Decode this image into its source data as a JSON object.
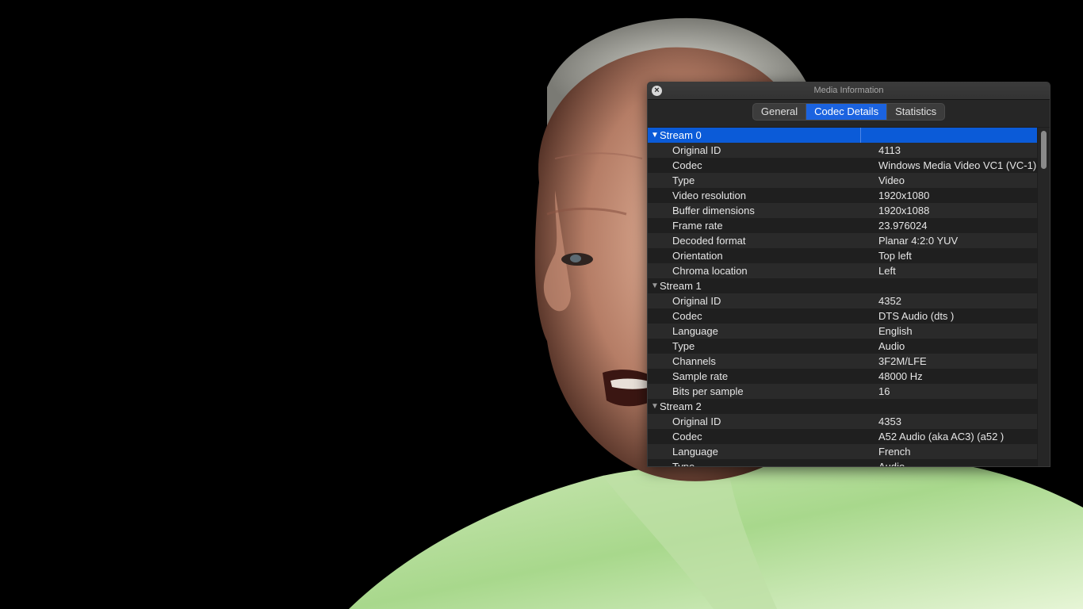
{
  "window": {
    "title": "Media Information"
  },
  "tabs": [
    {
      "label": "General",
      "active": false
    },
    {
      "label": "Codec Details",
      "active": true
    },
    {
      "label": "Statistics",
      "active": false
    }
  ],
  "streams": [
    {
      "label": "Stream 0",
      "selected": true,
      "rows": [
        {
          "key": "Original ID",
          "value": "4113"
        },
        {
          "key": "Codec",
          "value": "Windows Media Video VC1 (VC-1)"
        },
        {
          "key": "Type",
          "value": "Video"
        },
        {
          "key": "Video resolution",
          "value": "1920x1080"
        },
        {
          "key": "Buffer dimensions",
          "value": "1920x1088"
        },
        {
          "key": "Frame rate",
          "value": "23.976024"
        },
        {
          "key": "Decoded format",
          "value": "Planar 4:2:0 YUV"
        },
        {
          "key": "Orientation",
          "value": "Top left"
        },
        {
          "key": "Chroma location",
          "value": "Left"
        }
      ]
    },
    {
      "label": "Stream 1",
      "selected": false,
      "rows": [
        {
          "key": "Original ID",
          "value": "4352"
        },
        {
          "key": "Codec",
          "value": "DTS Audio (dts )"
        },
        {
          "key": "Language",
          "value": "English"
        },
        {
          "key": "Type",
          "value": "Audio"
        },
        {
          "key": "Channels",
          "value": "3F2M/LFE"
        },
        {
          "key": "Sample rate",
          "value": "48000 Hz"
        },
        {
          "key": "Bits per sample",
          "value": "16"
        }
      ]
    },
    {
      "label": "Stream 2",
      "selected": false,
      "rows": [
        {
          "key": "Original ID",
          "value": "4353"
        },
        {
          "key": "Codec",
          "value": "A52 Audio (aka AC3) (a52 )"
        },
        {
          "key": "Language",
          "value": "French"
        },
        {
          "key": "Type",
          "value": "Audio"
        }
      ]
    }
  ],
  "icons": {
    "close": "close-icon",
    "expanded": "disclosure-triangle-icon"
  },
  "colors": {
    "selection": "#0b5bd8",
    "active_tab": "#1b63e0",
    "panel_bg": "#1e1e1e"
  }
}
